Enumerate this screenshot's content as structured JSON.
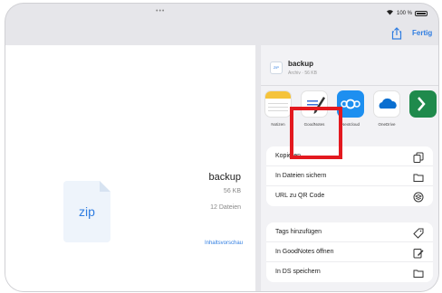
{
  "status": {
    "dots": "•••",
    "battery": "100 %"
  },
  "navbar": {
    "done_label": "Fertig",
    "share_icon": "share-icon"
  },
  "preview": {
    "file_type": "zip",
    "file_name": "backup",
    "file_size": "56 KB",
    "file_count": "12 Dateien",
    "quicklook_label": "Inhaltsvorschau"
  },
  "sheet": {
    "header": {
      "title": "backup",
      "subtitle": "Archiv · 56 KB",
      "icon_label": "ZIP"
    },
    "apps": [
      {
        "label": "Notizen",
        "icon": "notes-icon"
      },
      {
        "label": "GoodNotes",
        "icon": "goodnotes-icon"
      },
      {
        "label": "Nextcloud",
        "icon": "nextcloud-icon"
      },
      {
        "label": "OneDrive",
        "icon": "onedrive-icon"
      },
      {
        "label": "",
        "icon": "app-icon"
      }
    ],
    "actions_group1": [
      {
        "label": "Kopieren",
        "icon": "copy-icon"
      },
      {
        "label": "In Dateien sichern",
        "icon": "folder-icon"
      },
      {
        "label": "URL zu QR Code",
        "icon": "layers-icon"
      }
    ],
    "actions_group2": [
      {
        "label": "Tags hinzufügen",
        "icon": "tag-icon"
      },
      {
        "label": "In GoodNotes öffnen",
        "icon": "note-edit-icon"
      },
      {
        "label": "In DS speichern",
        "icon": "folder-icon"
      }
    ]
  },
  "colors": {
    "accent": "#2f7de1",
    "highlight": "#e3191f"
  }
}
